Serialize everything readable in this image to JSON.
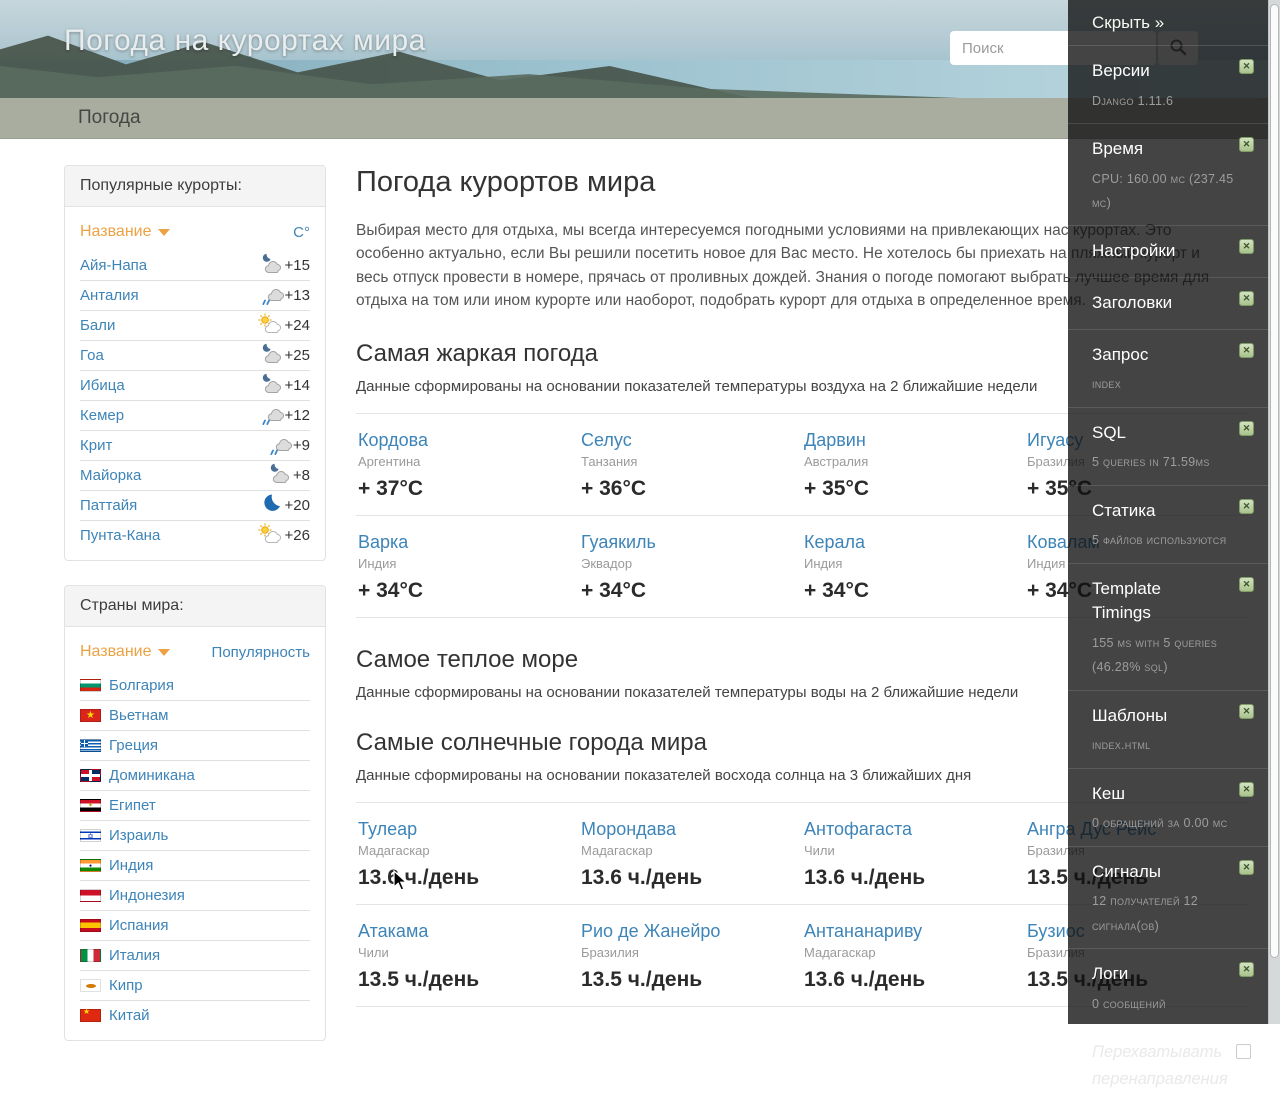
{
  "header": {
    "title": "Погода на курортах мира",
    "search_placeholder": "Поиск"
  },
  "nav": {
    "items": [
      {
        "label": "Погода"
      }
    ]
  },
  "sidebar": {
    "resorts": {
      "title": "Популярные курорты:",
      "col_name": "Название",
      "col_value": "С°",
      "rows": [
        {
          "name": "Айя-Напа",
          "icon": "moon-cloud",
          "temp": "+15"
        },
        {
          "name": "Анталия",
          "icon": "rain-cloud",
          "temp": "+13"
        },
        {
          "name": "Бали",
          "icon": "sun-cloud",
          "temp": "+24"
        },
        {
          "name": "Гоа",
          "icon": "moon-cloud",
          "temp": "+25"
        },
        {
          "name": "Ибица",
          "icon": "moon-cloud",
          "temp": "+14"
        },
        {
          "name": "Кемер",
          "icon": "rain-cloud",
          "temp": "+12"
        },
        {
          "name": "Крит",
          "icon": "rain-cloud",
          "temp": "+9"
        },
        {
          "name": "Майорка",
          "icon": "moon-cloud",
          "temp": "+8"
        },
        {
          "name": "Паттайя",
          "icon": "moon",
          "temp": "+20"
        },
        {
          "name": "Пунта-Кана",
          "icon": "sun-cloud",
          "temp": "+26"
        }
      ]
    },
    "countries": {
      "title": "Страны мира:",
      "col_name": "Название",
      "col_value": "Популярность",
      "rows": [
        {
          "name": "Болгария",
          "flag": "bg"
        },
        {
          "name": "Вьетнам",
          "flag": "vn"
        },
        {
          "name": "Греция",
          "flag": "gr"
        },
        {
          "name": "Доминикана",
          "flag": "do"
        },
        {
          "name": "Египет",
          "flag": "eg"
        },
        {
          "name": "Израиль",
          "flag": "il"
        },
        {
          "name": "Индия",
          "flag": "in"
        },
        {
          "name": "Индонезия",
          "flag": "id"
        },
        {
          "name": "Испания",
          "flag": "es"
        },
        {
          "name": "Италия",
          "flag": "it"
        },
        {
          "name": "Кипр",
          "flag": "cy"
        },
        {
          "name": "Китай",
          "flag": "cn"
        }
      ]
    }
  },
  "main": {
    "title": "Погода курортов мира",
    "intro": "Выбирая место для отдыха, мы всегда интересуемся погодными условиями на привлекающих нас курортах. Это особенно актуально, если Вы решили посетить новое для Вас место. Не хотелось бы приехать на пляжный курорт и весь отпуск провести в номере, прячась от проливных дождей. Знания о погоде помогают выбрать лучшее время для отдыха на том или ином курорте или наоборот, подобрать курорт для отдыха в определенное время.",
    "sections": [
      {
        "title": "Самая жаркая погода",
        "subtitle": "Данные сформированы на основании показателей температуры воздуха на 2 ближайшие недели",
        "cards": [
          {
            "city": "Кордова",
            "country": "Аргентина",
            "value": "+ 37°C"
          },
          {
            "city": "Селус",
            "country": "Танзания",
            "value": "+ 36°C"
          },
          {
            "city": "Дарвин",
            "country": "Австралия",
            "value": "+ 35°C"
          },
          {
            "city": "Игуасу",
            "country": "Бразилия",
            "value": "+ 35°C"
          },
          {
            "city": "Варка",
            "country": "Индия",
            "value": "+ 34°C"
          },
          {
            "city": "Гуаякиль",
            "country": "Эквадор",
            "value": "+ 34°C"
          },
          {
            "city": "Керала",
            "country": "Индия",
            "value": "+ 34°C"
          },
          {
            "city": "Ковалам",
            "country": "Индия",
            "value": "+ 34°C"
          }
        ]
      },
      {
        "title": "Самое теплое море",
        "subtitle": "Данные сформированы на основании показателей температуры воды на 2 ближайшие недели",
        "cards": []
      },
      {
        "title": "Самые солнечные города мира",
        "subtitle": "Данные сформированы на основании показателей восхода солнца на 3 ближайших дня",
        "cards": [
          {
            "city": "Тулеар",
            "country": "Мадагаскар",
            "value": "13.6 ч./день"
          },
          {
            "city": "Морондава",
            "country": "Мадагаскар",
            "value": "13.6 ч./день"
          },
          {
            "city": "Антофагаста",
            "country": "Чили",
            "value": "13.6 ч./день"
          },
          {
            "city": "Ангра Дус Рейс",
            "country": "Бразилия",
            "value": "13.5 ч./день"
          },
          {
            "city": "Атакама",
            "country": "Чили",
            "value": "13.5 ч./день"
          },
          {
            "city": "Рио де Жанейро",
            "country": "Бразилия",
            "value": "13.5 ч./день"
          },
          {
            "city": "Антананариву",
            "country": "Мадагаскар",
            "value": "13.6 ч./день"
          },
          {
            "city": "Бузиос",
            "country": "Бразилия",
            "value": "13.5 ч./день"
          }
        ]
      }
    ]
  },
  "debug_toolbar": {
    "hide_label": "Скрыть »",
    "panels": [
      {
        "id": "versions",
        "title": "Версии",
        "lines": "Django 1.11.6"
      },
      {
        "id": "timer",
        "title": "Время",
        "lines": "CPU: 160.00 мс (237.45 мс)"
      },
      {
        "id": "settings",
        "title": "Настройки",
        "lines": ""
      },
      {
        "id": "headers",
        "title": "Заголовки",
        "lines": ""
      },
      {
        "id": "request",
        "title": "Запрос",
        "lines": "index"
      },
      {
        "id": "sql",
        "title": "SQL",
        "lines": "5 queries in 71.59ms"
      },
      {
        "id": "staticfiles",
        "title": "Статика",
        "lines": "5 файлов используются"
      },
      {
        "id": "template-timings",
        "title": "Template Timings",
        "lines": "155 ms with 5 queries (46.28% sql)"
      },
      {
        "id": "templates",
        "title": "Шаблоны",
        "lines": "index.html"
      },
      {
        "id": "cache",
        "title": "Кеш",
        "lines": "0 обращений за 0.00 мс"
      },
      {
        "id": "signals",
        "title": "Сигналы",
        "lines": "12 получателей 12 сигнала(ов)"
      },
      {
        "id": "logging",
        "title": "Логи",
        "lines": "0 сообщений"
      }
    ],
    "redirect_label": "Перехватывать перенаправления"
  },
  "colors": {
    "link_blue": "#3d84b8",
    "accent_orange": "#eca243",
    "nav_bg": "#a8ada0",
    "toolbar_bg": "rgba(16,16,16,0.78)",
    "toggle_green": "#a9c28d"
  }
}
